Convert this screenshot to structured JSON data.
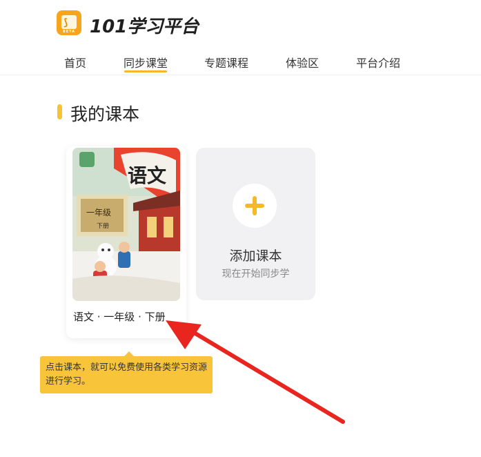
{
  "header": {
    "logo_text": "101学习平台",
    "logo_badge": "BETA"
  },
  "nav": {
    "items": [
      "首页",
      "同步课堂",
      "专题课程",
      "体验区",
      "平台介绍"
    ],
    "active": "同步课堂"
  },
  "section": {
    "title": "我的课本"
  },
  "book": {
    "cover_title": "语文",
    "grade": "一年级",
    "volume": "下册",
    "caption": "语文 · 一年级 · 下册"
  },
  "add_book": {
    "title": "添加课本",
    "subtitle": "现在开始同步学"
  },
  "tooltip": {
    "text": "点击课本，就可以免费使用各类学习资源进行学习。"
  },
  "colors": {
    "accent": "#f7b72a",
    "tooltip_bg": "#f8c43a",
    "arrow": "#e8251f"
  }
}
